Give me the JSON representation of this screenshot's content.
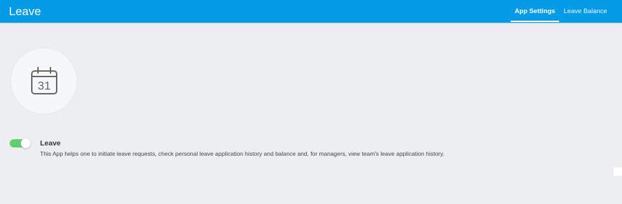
{
  "header": {
    "title": "Leave",
    "tabs": [
      {
        "label": "App Settings",
        "active": true
      },
      {
        "label": "Leave Balance",
        "active": false
      }
    ],
    "color": "#059be6"
  },
  "app": {
    "icon": "calendar-icon",
    "icon_day": "31",
    "name": "Leave",
    "description": "This App helps one to initiate leave requests, check personal leave application history and balance and, for managers, view team's leave application history.",
    "enabled": true,
    "toggle_color": "#5ed06d"
  }
}
